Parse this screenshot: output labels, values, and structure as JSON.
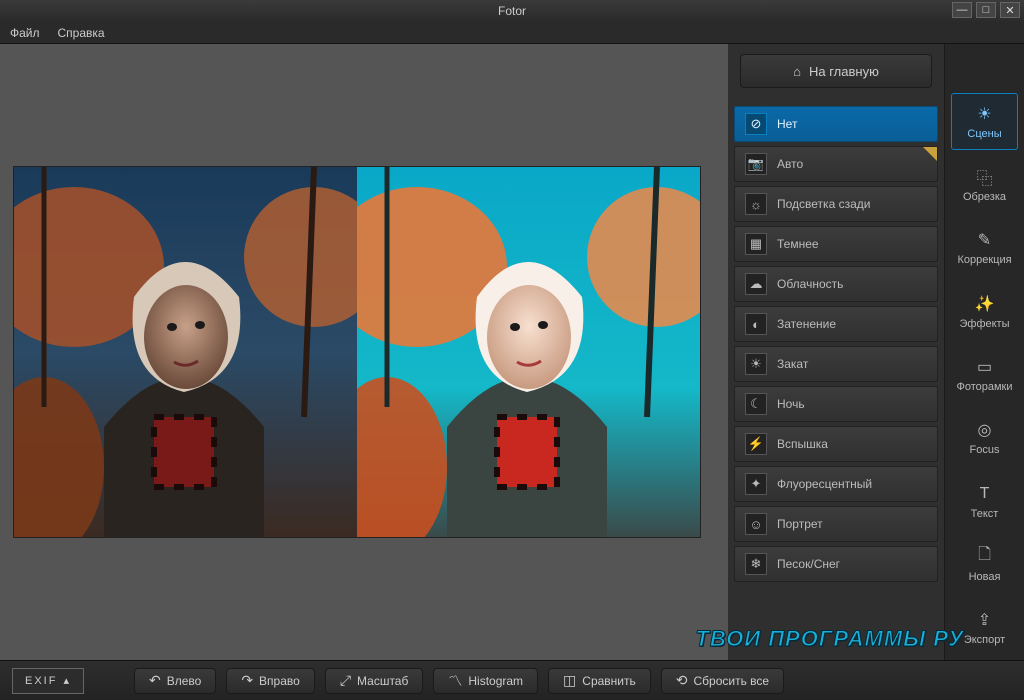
{
  "titlebar": {
    "title": "Fotor"
  },
  "menu": {
    "file": "Файл",
    "help": "Справка"
  },
  "home_button": "На главную",
  "scenes": [
    {
      "label": "Нет",
      "icon": "⊘",
      "selected": true
    },
    {
      "label": "Авто",
      "icon": "📷",
      "corner": true
    },
    {
      "label": "Подсветка сзади",
      "icon": "☼"
    },
    {
      "label": "Темнее",
      "icon": "▦"
    },
    {
      "label": "Облачность",
      "icon": "☁"
    },
    {
      "label": "Затенение",
      "icon": "◐"
    },
    {
      "label": "Закат",
      "icon": "☀"
    },
    {
      "label": "Ночь",
      "icon": "☾"
    },
    {
      "label": "Вспышка",
      "icon": "⚡"
    },
    {
      "label": "Флуоресцентный",
      "icon": "✦"
    },
    {
      "label": "Портрет",
      "icon": "☺"
    },
    {
      "label": "Песок/Снег",
      "icon": "❄"
    }
  ],
  "tools": [
    {
      "label": "Сцены",
      "icon": "☀",
      "active": true
    },
    {
      "label": "Обрезка",
      "icon": "⿻"
    },
    {
      "label": "Коррекция",
      "icon": "✎"
    },
    {
      "label": "Эффекты",
      "icon": "✨"
    },
    {
      "label": "Фоторамки",
      "icon": "▭"
    },
    {
      "label": "Focus",
      "icon": "◎"
    },
    {
      "label": "Текст",
      "icon": "T"
    }
  ],
  "tools_bottom": [
    {
      "label": "Новая",
      "icon": "🗋"
    },
    {
      "label": "Экспорт",
      "icon": "⇪"
    }
  ],
  "bottom": {
    "exif": "EXIF",
    "left": "Влево",
    "right": "Вправо",
    "zoom": "Масштаб",
    "histogram": "Histogram",
    "compare": "Сравнить",
    "reset": "Сбросить все"
  },
  "watermark": "ТВОИ ПРОГРАММЫ РУ"
}
